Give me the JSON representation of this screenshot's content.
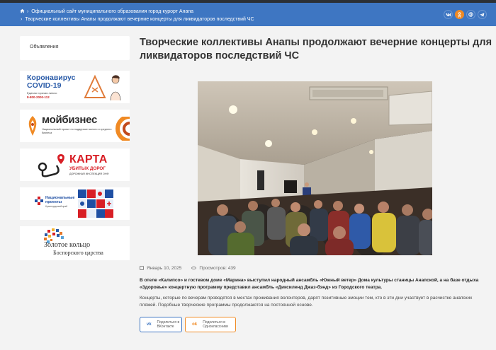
{
  "breadcrumb": {
    "home_link": "Официальный сайт муниципального образования город-курорт Анапа",
    "current": "Творческие коллективы Анапы продолжают вечерние концерты для ликвидаторов последствий ЧС"
  },
  "header": {
    "social": [
      {
        "name": "vk",
        "glyph": "vk"
      },
      {
        "name": "ok",
        "glyph": "ok"
      },
      {
        "name": "mail",
        "glyph": "@"
      },
      {
        "name": "telegram",
        "glyph": "›"
      }
    ]
  },
  "sidebar": {
    "menu_item": "Объявления",
    "banners": {
      "covid": {
        "title_line1": "Коронавирус",
        "title_line2": "COVID-19",
        "hotline_label": "Единая горячая линия:",
        "hotline_number": "8-800-2000-112"
      },
      "moybiznes": {
        "brand": "мойбизнес",
        "subtitle": "Национальный проект по поддержке малого и среднего бизнеса"
      },
      "karta": {
        "title": "КАРТА",
        "subtitle": "УБИТЫХ ДОРОГ",
        "caption": "ДОРОЖНАЯ ИНСПЕКЦИЯ ОНФ"
      },
      "natsproekty": {
        "line1": "Национальные",
        "line2": "проекты",
        "line3": "Краснодарский край"
      },
      "zolotoe": {
        "line1": "Золотое кольцо",
        "line2": "Боспорского царства"
      }
    }
  },
  "article": {
    "title": "Творческие коллективы Анапы продолжают вечерние концерты для ликвидаторов последствий ЧС",
    "date": "Январь 10, 2025",
    "views": "Просмотров: 439",
    "lead": "В отеле «Калипсо» и гостевом доме «Марина» выступил народный ансамбль «Южный ветер» Дома культуры станицы Анапской, а на базе отдыха «Здоровье» концертную программу представил ансамбль «Диксиленд Джаз-бэнд» из Городского театра.",
    "body": "Концерты, которые по вечерам проводятся в местах проживания волонтеров, дарят позитивные эмоции тем, кто в эти дни участвует в расчистке анапских пляжей. Подобные творческие программы продолжаются на постоянной основе.",
    "share": {
      "vk_label": "Поделиться в ВКонтакте",
      "ok_label": "Поделиться в Одноклассники"
    }
  },
  "colors": {
    "header_blue": "#3e76c2",
    "accent_orange": "#f08a24",
    "page_bg": "#f3f3f3"
  }
}
